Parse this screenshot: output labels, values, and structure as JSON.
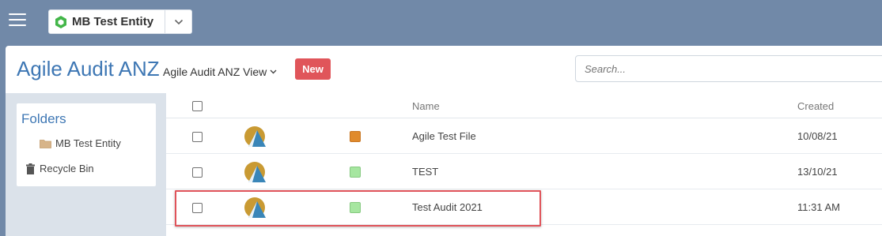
{
  "topbar": {
    "entity_label": "MB Test Entity"
  },
  "header": {
    "title": "Agile Audit ANZ",
    "view_label": "Agile Audit ANZ View",
    "new_button": "New",
    "search_placeholder": "Search..."
  },
  "folders": {
    "title": "Folders",
    "items": [
      {
        "label": "MB Test Entity",
        "icon": "folder-icon"
      }
    ],
    "recycle_bin": "Recycle Bin"
  },
  "table": {
    "columns": {
      "name": "Name",
      "created": "Created"
    },
    "rows": [
      {
        "name": "Agile Test File",
        "created": "10/08/21",
        "status_color": "#e08a2c"
      },
      {
        "name": "TEST",
        "created": "13/10/21",
        "status_color": "#a6e6a0"
      },
      {
        "name": "Test Audit 2021",
        "created": "11:31 AM",
        "status_color": "#a6e6a0"
      }
    ]
  },
  "colors": {
    "topbar": "#7189a8",
    "accent": "#3e77b4",
    "new_button": "#e0555a",
    "highlight": "#e0535a"
  }
}
